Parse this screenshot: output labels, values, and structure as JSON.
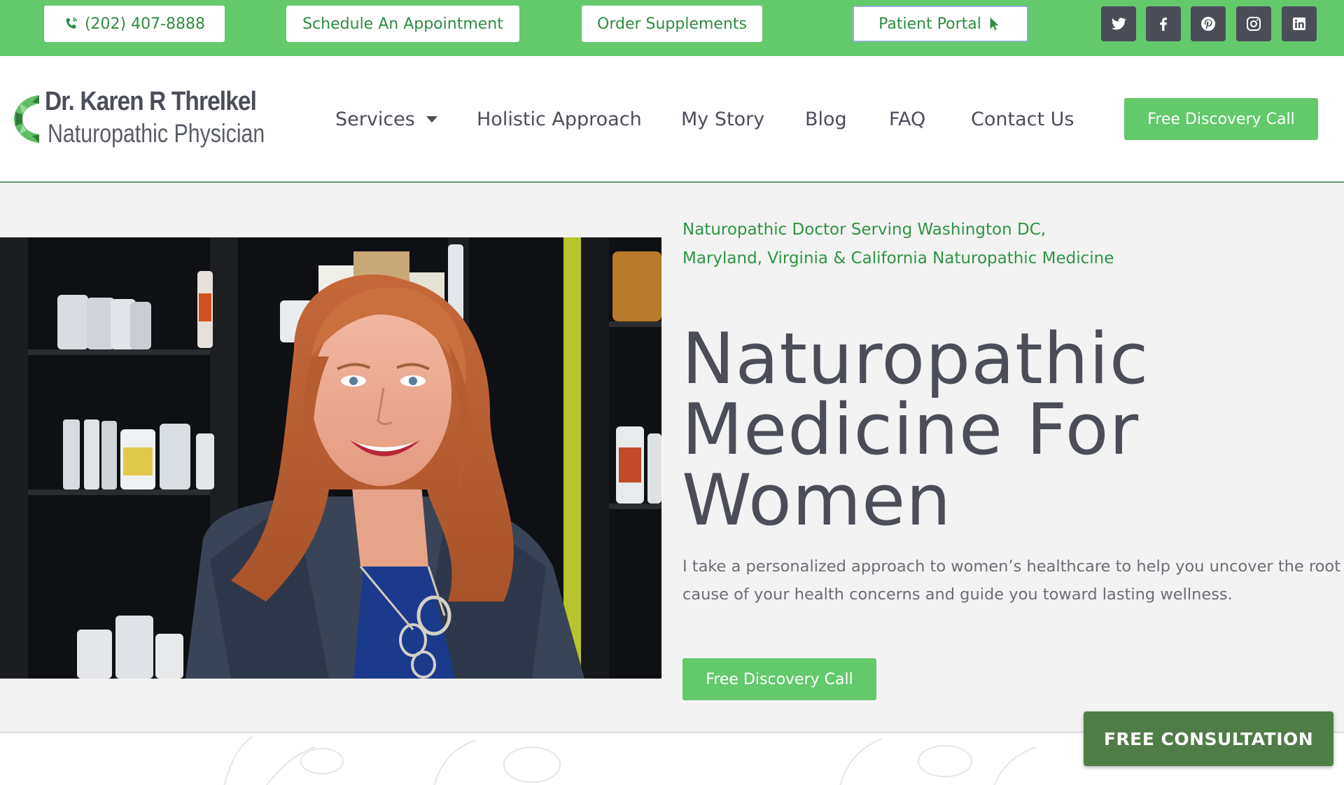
{
  "topbar": {
    "phone": "(202) 407-8888",
    "schedule": "Schedule An Appointment",
    "order": "Order Supplements",
    "portal": "Patient Portal",
    "social": [
      "twitter-icon",
      "facebook-icon",
      "pinterest-icon",
      "instagram-icon",
      "linkedin-icon"
    ]
  },
  "header": {
    "logo_name": "Dr. Karen R Threlkel",
    "logo_sub": "Naturopathic Physician",
    "nav": [
      {
        "label": "Services"
      },
      {
        "label": "Holistic Approach"
      },
      {
        "label": "My Story"
      },
      {
        "label": "Blog"
      },
      {
        "label": "FAQ"
      },
      {
        "label": "Contact Us"
      }
    ],
    "cta": "Free Discovery Call"
  },
  "hero": {
    "tagline_1": "Naturopathic Doctor Serving Washington DC,",
    "tagline_2": "Maryland, Virginia & California Naturopathic Medicine",
    "headline_1": "Naturopathic",
    "headline_2": "Medicine For",
    "headline_3": "Women",
    "intro_1": "I take a personalized approach to women’s healthcare to help you uncover the root",
    "intro_2": "cause of your health concerns and guide you toward lasting wellness.",
    "cta": "Free Discovery Call"
  },
  "floating_cta": "FREE CONSULTATION",
  "colors": {
    "brand_green": "#63c96b",
    "dark_text": "#4b4e59",
    "accent_green_text": "#2e9444",
    "social_bg": "#4b4e59",
    "floating_cta_bg": "#4f7d46"
  }
}
